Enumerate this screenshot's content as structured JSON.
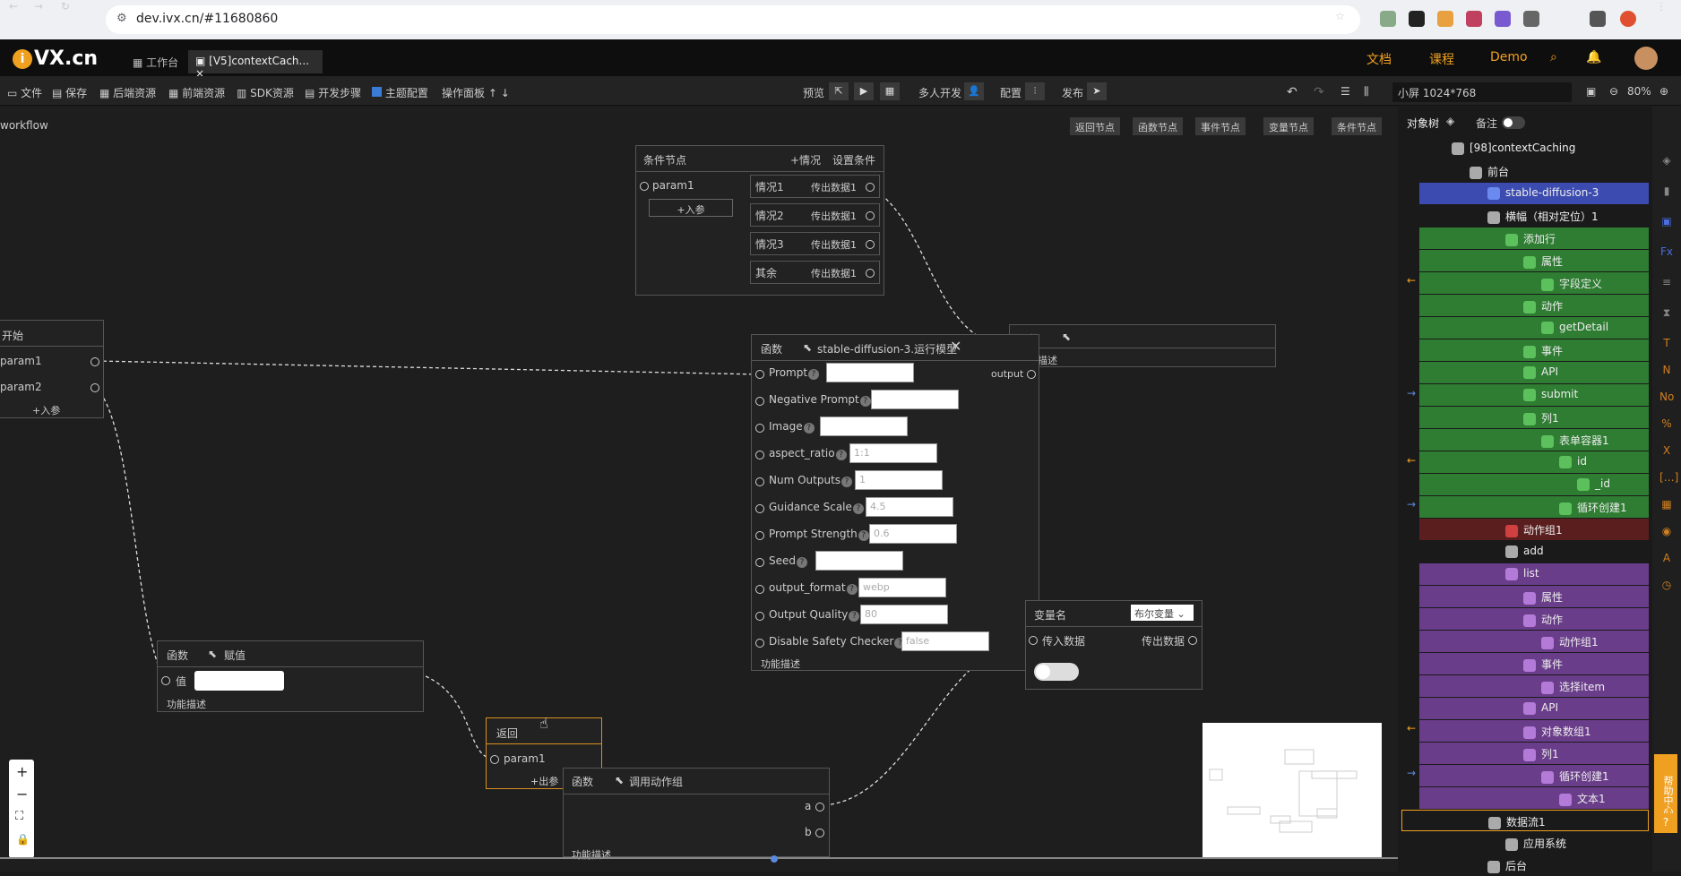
{
  "browser": {
    "url": "dev.ivx.cn/#11680860"
  },
  "app": {
    "logo": "VX.cn",
    "tabs": [
      "工作台",
      "[V5]contextCach..."
    ],
    "top_links": [
      "文档",
      "课程",
      "Demo"
    ]
  },
  "toolbar": {
    "items": [
      "文件",
      "保存",
      "后端资源",
      "前端资源",
      "SDK资源",
      "开发步骤",
      "主题配置",
      "操作面板"
    ],
    "preview": "预览",
    "multi": "多人开发",
    "config": "配置",
    "publish": "发布",
    "screen": "小屏 1024*768",
    "zoom": "80%"
  },
  "canvas": {
    "title": "workflow",
    "node_buttons": [
      "返回节点",
      "函数节点",
      "事件节点",
      "变量节点",
      "条件节点"
    ]
  },
  "cond_node": {
    "title": "条件节点",
    "add_case": "+情况",
    "set_cond": "设置条件",
    "param": "param1",
    "add_param": "+入参",
    "cases": [
      "情况1",
      "情况2",
      "情况3",
      "其余"
    ],
    "out": "传出数据1"
  },
  "start_node": {
    "title": "开始",
    "params": [
      "param1",
      "param2"
    ],
    "add_param": "+入参"
  },
  "func_node_small": {
    "title": "函数",
    "desc": "功能描述"
  },
  "sd_node": {
    "title": "函数",
    "name": "stable-diffusion-3.运行模型",
    "output": "output",
    "params": [
      {
        "label": "Prompt",
        "value": ""
      },
      {
        "label": "Negative Prompt",
        "value": ""
      },
      {
        "label": "Image",
        "value": ""
      },
      {
        "label": "aspect_ratio",
        "value": "1:1"
      },
      {
        "label": "Num Outputs",
        "value": "1"
      },
      {
        "label": "Guidance Scale",
        "value": "4.5"
      },
      {
        "label": "Prompt Strength",
        "value": "0.6"
      },
      {
        "label": "Seed",
        "value": ""
      },
      {
        "label": "output_format",
        "value": "webp"
      },
      {
        "label": "Output Quality",
        "value": "80"
      },
      {
        "label": "Disable Safety Checker",
        "value": "false"
      }
    ],
    "desc": "功能描述"
  },
  "var_node": {
    "title": "变量名",
    "type": "布尔变量",
    "in": "传入数据",
    "out": "传出数据"
  },
  "assign_node": {
    "title": "函数",
    "name": "赋值",
    "value_label": "值",
    "desc": "功能描述"
  },
  "return_node": {
    "title": "返回",
    "param": "param1",
    "add_out": "+出参"
  },
  "call_node": {
    "title": "函数",
    "name": "调用动作组",
    "outs": [
      "a",
      "b"
    ],
    "desc": "功能描述"
  },
  "panel": {
    "tab": "对象树",
    "note": "备注",
    "tree": [
      {
        "label": "[98]contextCaching",
        "indent": 0,
        "color": ""
      },
      {
        "label": "前台",
        "indent": 1,
        "color": ""
      },
      {
        "label": "stable-diffusion-3",
        "indent": 2,
        "color": "b"
      },
      {
        "label": "横幅（相对定位）1",
        "indent": 2,
        "color": ""
      },
      {
        "label": "添加行",
        "indent": 3,
        "color": "g"
      },
      {
        "label": "属性",
        "indent": 4,
        "color": "g"
      },
      {
        "label": "字段定义",
        "indent": 5,
        "color": "g"
      },
      {
        "label": "动作",
        "indent": 4,
        "color": "g"
      },
      {
        "label": "getDetail",
        "indent": 5,
        "color": "g"
      },
      {
        "label": "事件",
        "indent": 4,
        "color": "g"
      },
      {
        "label": "API",
        "indent": 4,
        "color": "g"
      },
      {
        "label": "submit",
        "indent": 4,
        "color": "g"
      },
      {
        "label": "列1",
        "indent": 4,
        "color": "g"
      },
      {
        "label": "表单容器1",
        "indent": 5,
        "color": "g"
      },
      {
        "label": "id",
        "indent": 6,
        "color": "g"
      },
      {
        "label": "_id",
        "indent": 7,
        "color": "g"
      },
      {
        "label": "循环创建1",
        "indent": 6,
        "color": "g"
      },
      {
        "label": "动作组1",
        "indent": 3,
        "color": "r"
      },
      {
        "label": "add",
        "indent": 3,
        "color": ""
      },
      {
        "label": "list",
        "indent": 3,
        "color": "p"
      },
      {
        "label": "属性",
        "indent": 4,
        "color": "p"
      },
      {
        "label": "动作",
        "indent": 4,
        "color": "p"
      },
      {
        "label": "动作组1",
        "indent": 5,
        "color": "p"
      },
      {
        "label": "事件",
        "indent": 4,
        "color": "p"
      },
      {
        "label": "选择item",
        "indent": 5,
        "color": "p"
      },
      {
        "label": "API",
        "indent": 4,
        "color": "p"
      },
      {
        "label": "对象数组1",
        "indent": 4,
        "color": "p"
      },
      {
        "label": "列1",
        "indent": 4,
        "color": "p"
      },
      {
        "label": "循环创建1",
        "indent": 5,
        "color": "p"
      },
      {
        "label": "文本1",
        "indent": 6,
        "color": "p"
      },
      {
        "label": "数据流1",
        "indent": 3,
        "color": ""
      },
      {
        "label": "应用系统",
        "indent": 3,
        "color": ""
      },
      {
        "label": "后台",
        "indent": 2,
        "color": ""
      }
    ]
  },
  "help": "帮助中心"
}
